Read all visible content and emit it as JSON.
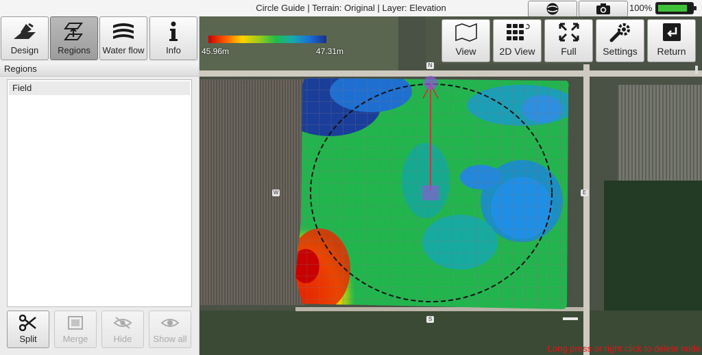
{
  "title_bar": {
    "title": "Circle Guide | Terrain: Original | Layer: Elevation",
    "battery_percent": "100%",
    "battery_level": 1.0,
    "globe_icon": "globe-icon",
    "camera_icon": "camera-icon"
  },
  "left_tabs": [
    {
      "label": "Design",
      "icon": "design-icon"
    },
    {
      "label": "Regions",
      "icon": "regions-icon",
      "active": true
    },
    {
      "label": "Water flow",
      "icon": "water-flow-icon"
    },
    {
      "label": "Info",
      "icon": "info-icon"
    }
  ],
  "regions": {
    "header": "Regions",
    "items": [
      "Field"
    ]
  },
  "tools": {
    "split": "Split",
    "merge": "Merge",
    "hide": "Hide",
    "show_all": "Show all"
  },
  "legend": {
    "min": "45.96m",
    "max": "47.31m"
  },
  "map_buttons": {
    "view": "View",
    "view_2d": "2D View",
    "full": "Full",
    "settings": "Settings",
    "return": "Return"
  },
  "compass": {
    "n": "N",
    "s": "S",
    "e": "E",
    "w": "W"
  },
  "hint": "Long press or right click to delete node",
  "colors": {
    "accent_red": "#e01616",
    "node_purple": "#8a5bd6",
    "guide_line": "#e0203a"
  }
}
